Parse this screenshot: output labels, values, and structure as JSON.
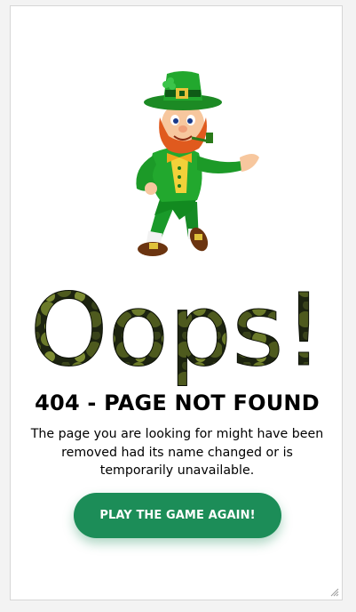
{
  "error": {
    "oops_text": "Oops!",
    "headline": "404 - PAGE NOT FOUND",
    "message": "The page you are looking for might have been removed had its name changed or is temporarily unavailable.",
    "button_label": "PLAY THE GAME AGAIN!"
  },
  "colors": {
    "button": "#1c8d58",
    "oops_pattern_dark": "#1d2410",
    "oops_pattern_light": "#6b7a2a",
    "leprechaun_green": "#1f9a2c"
  },
  "icons": {
    "mascot": "leprechaun-illustration",
    "grip": "resize-grip-icon"
  }
}
